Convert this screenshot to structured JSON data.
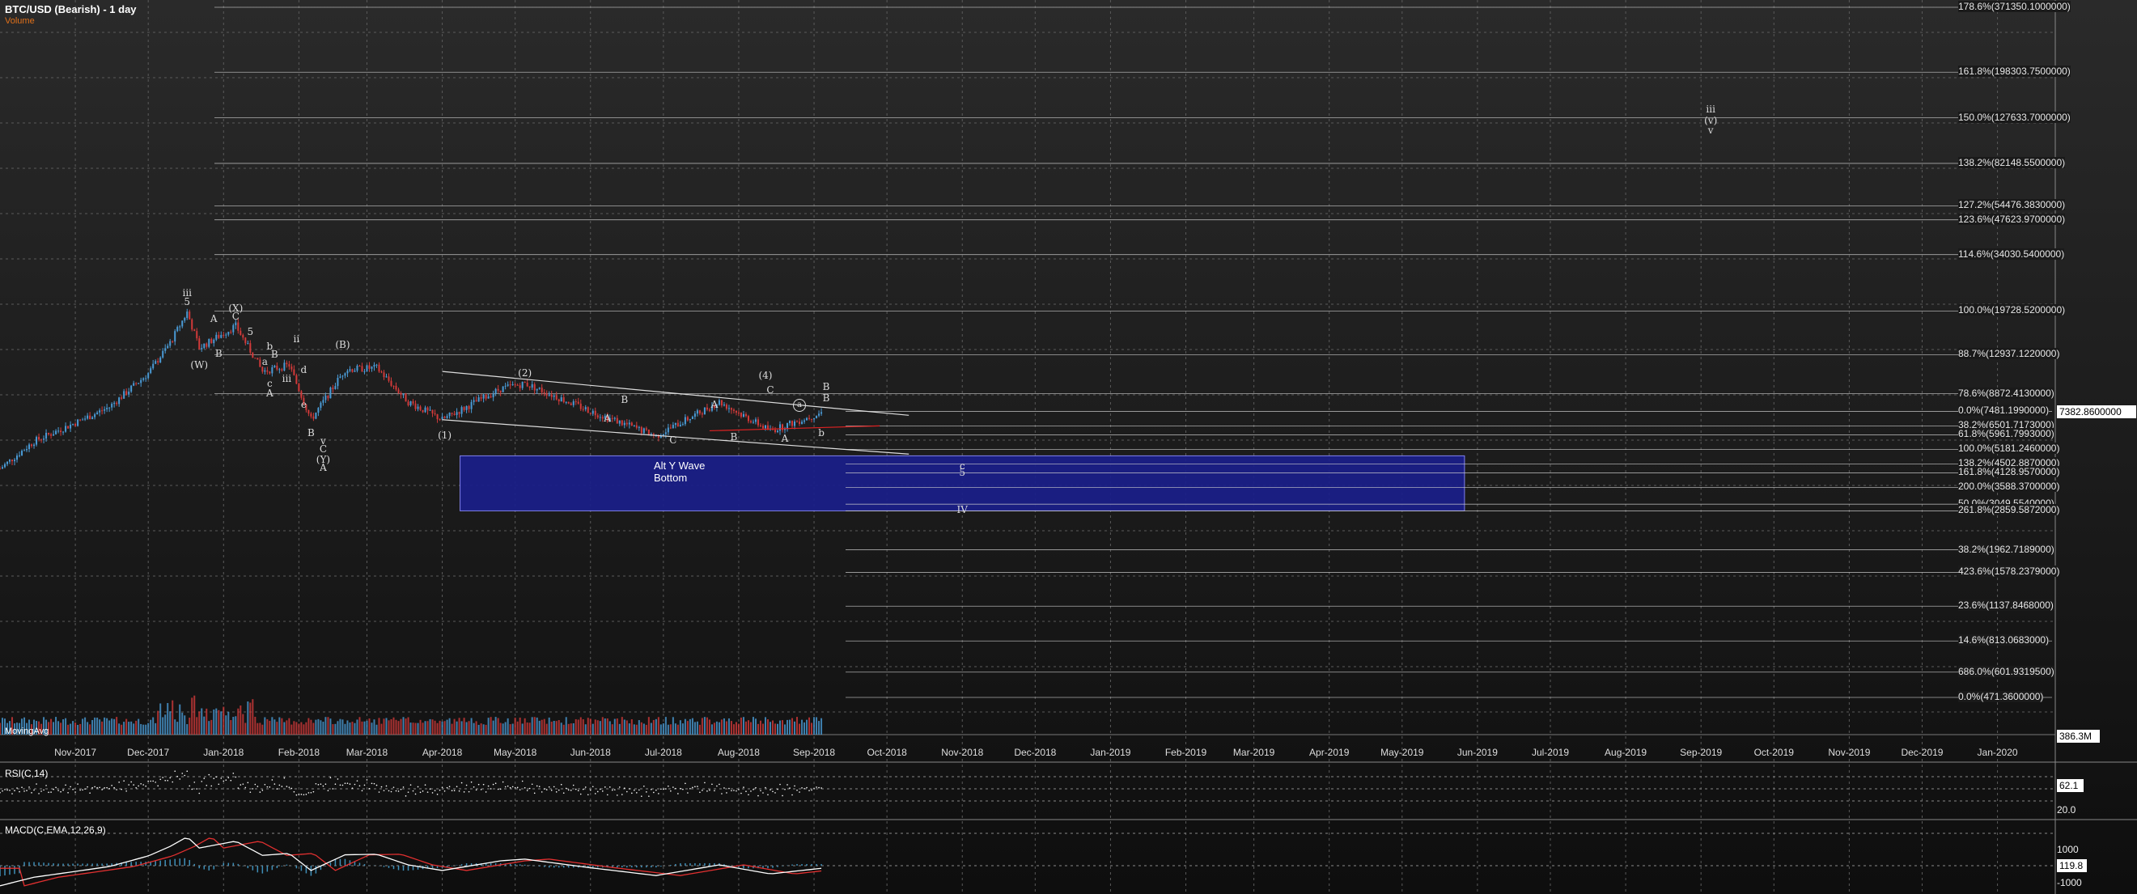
{
  "header": {
    "title": "BTC/USD (Bearish) - 1 day",
    "volume_label": "Volume"
  },
  "panels": {
    "rsi_title": "RSI(C,14)",
    "macd_title": "MACD(C,EMA,12,26,9)",
    "volume_overlay": "MovingAvg"
  },
  "colors": {
    "bg": "#131313",
    "grid": "#5a5a5a",
    "up": "#4a9bd6",
    "down": "#d23a3a",
    "box": "#1a1f8a",
    "rsi": "#ffffff",
    "macd": "#ffffff",
    "signal": "#e23030",
    "hist": "#3f8fb8"
  },
  "right_axis": {
    "last_price": "7382.8600000",
    "volume_value": "386.3M",
    "rsi_ticks": [
      "62.1",
      "20.0"
    ],
    "macd_ticks": [
      "1000",
      "119.8",
      "-1000"
    ]
  },
  "box_label": "Alt Y Wave Bottom",
  "chart_data": {
    "type": "candlestick",
    "title": "BTC/USD (Bearish) - 1 day",
    "x_ticks": [
      "Nov-2017",
      "Dec-2017",
      "Jan-2018",
      "Feb-2018",
      "Mar-2018",
      "Apr-2018",
      "May-2018",
      "Jun-2018",
      "Jul-2018",
      "Aug-2018",
      "Sep-2018",
      "Oct-2018",
      "Nov-2018",
      "Dec-2018",
      "Jan-2019",
      "Feb-2019",
      "Mar-2019",
      "Apr-2019",
      "May-2019",
      "Jun-2019",
      "Jul-2019",
      "Aug-2019",
      "Sep-2019",
      "Oct-2019",
      "Nov-2019",
      "Dec-2019",
      "Jan-2020"
    ],
    "fib_levels": [
      {
        "label": "178.6%(371350.1000000)",
        "value": 371350.1
      },
      {
        "label": "161.8%(198303.7500000)",
        "value": 198303.75
      },
      {
        "label": "150.0%(127633.7000000)",
        "value": 127633.7
      },
      {
        "label": "138.2%(82148.5500000)",
        "value": 82148.55
      },
      {
        "label": "127.2%(54476.3830000)",
        "value": 54476.383
      },
      {
        "label": "123.6%(47623.9700000)",
        "value": 47623.97
      },
      {
        "label": "114.6%(34030.5400000)",
        "value": 34030.54
      },
      {
        "label": "100.0%(19728.5200000)",
        "value": 19728.52
      },
      {
        "label": "88.7%(12937.1220000)",
        "value": 12937.122
      },
      {
        "label": "78.6%(8872.4130000)",
        "value": 8872.413
      },
      {
        "label": "0.0%(7481.1990000)",
        "value": 7481.199
      },
      {
        "label": "38.2%(6501.7173000)",
        "value": 6501.7173
      },
      {
        "label": "61.8%(5961.7993000)",
        "value": 5961.7993
      },
      {
        "label": "100.0%(5181.2460000)",
        "value": 5181.246
      },
      {
        "label": "138.2%(4502.8870000)",
        "value": 4502.887
      },
      {
        "label": "161.8%(4128.9570000)",
        "value": 4128.957
      },
      {
        "label": "200.0%(3588.3700000)",
        "value": 3588.37
      },
      {
        "label": "50.0%(3049.5540000)",
        "value": 3049.554
      },
      {
        "label": "261.8%(2859.5872000)",
        "value": 2859.5872
      },
      {
        "label": "38.2%(1962.7189000)",
        "value": 1962.7189
      },
      {
        "label": "423.6%(1578.2379000)",
        "value": 1578.2379
      },
      {
        "label": "23.6%(1137.8468000)",
        "value": 1137.8468
      },
      {
        "label": "14.6%(813.0683000)",
        "value": 813.0683
      },
      {
        "label": "686.0%(601.9319500)",
        "value": 601.93195
      },
      {
        "label": "0.0%(471.3600000)",
        "value": 471.36
      }
    ],
    "price_series": [
      {
        "date": "2017-10-01",
        "close": 4300
      },
      {
        "date": "2017-10-15",
        "close": 5600
      },
      {
        "date": "2017-11-01",
        "close": 6700
      },
      {
        "date": "2017-11-15",
        "close": 7800
      },
      {
        "date": "2017-12-01",
        "close": 10800
      },
      {
        "date": "2017-12-10",
        "close": 14500
      },
      {
        "date": "2017-12-17",
        "close": 19500
      },
      {
        "date": "2017-12-22",
        "close": 13800
      },
      {
        "date": "2018-01-06",
        "close": 17100
      },
      {
        "date": "2018-01-17",
        "close": 11000
      },
      {
        "date": "2018-01-28",
        "close": 11700
      },
      {
        "date": "2018-02-06",
        "close": 6900
      },
      {
        "date": "2018-02-20",
        "close": 11200
      },
      {
        "date": "2018-03-05",
        "close": 11400
      },
      {
        "date": "2018-03-18",
        "close": 8200
      },
      {
        "date": "2018-04-01",
        "close": 6900
      },
      {
        "date": "2018-04-25",
        "close": 9300
      },
      {
        "date": "2018-05-05",
        "close": 9800
      },
      {
        "date": "2018-06-01",
        "close": 7500
      },
      {
        "date": "2018-06-28",
        "close": 5900
      },
      {
        "date": "2018-07-24",
        "close": 8200
      },
      {
        "date": "2018-08-14",
        "close": 6200
      },
      {
        "date": "2018-09-04",
        "close": 7382.86
      }
    ],
    "wave_labels": [
      "iii",
      "5",
      "(X)",
      "C",
      "A",
      "B",
      "(W)",
      "5",
      "b",
      "B",
      "a",
      "c",
      "A",
      "ii",
      "d",
      "iii",
      "e",
      "(B)",
      "B",
      "v",
      "C",
      "(Y)",
      "A",
      "(2)",
      "B",
      "A",
      "(1)",
      "C",
      "A",
      "B",
      "(4)",
      "C",
      "B",
      "a",
      "A",
      "b",
      "B",
      "5",
      "c",
      "IV",
      "iii",
      "(v)",
      "v"
    ],
    "annotations": [
      {
        "date": "2018-07-05",
        "value": 4300,
        "text": "Alt Y Wave Bottom"
      }
    ],
    "target_box": {
      "from": "2018-04-01",
      "to": "2019-06-01",
      "low": 2859.59,
      "high": 5181.25
    }
  }
}
